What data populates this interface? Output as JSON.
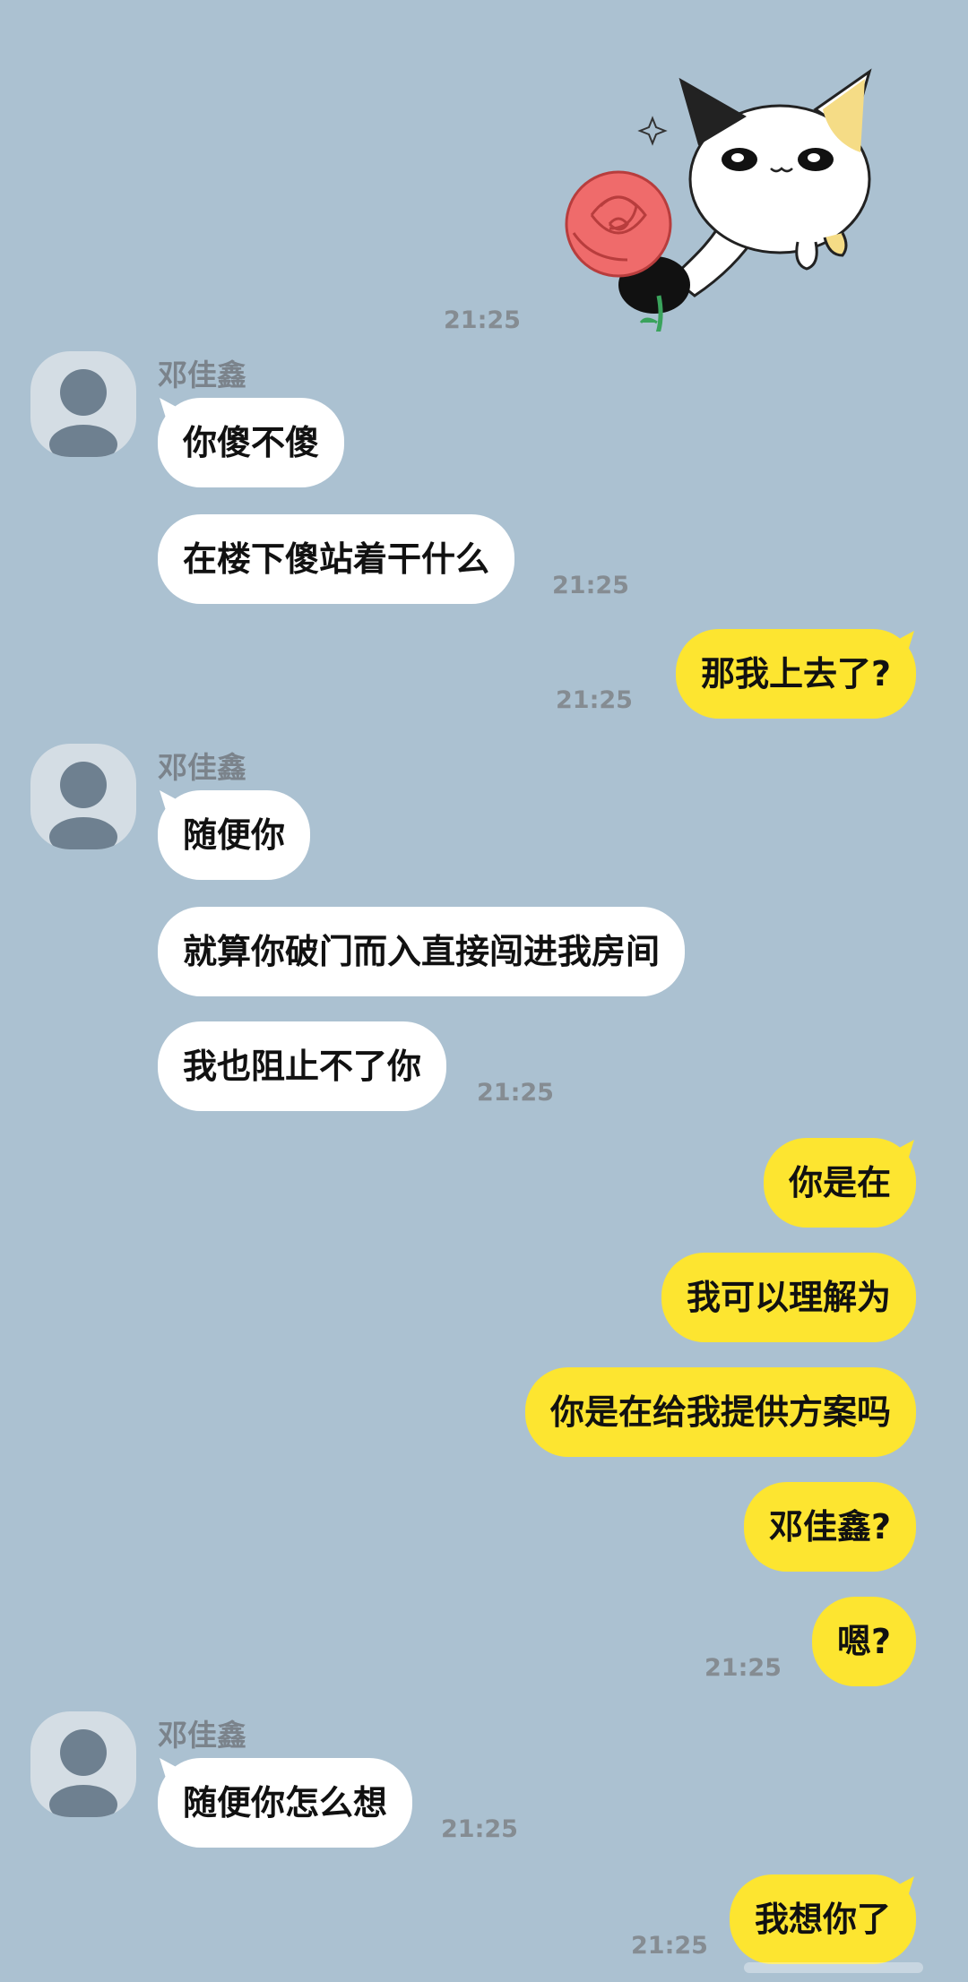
{
  "colors": {
    "background": "#abc1d1",
    "incoming_bubble": "#ffffff",
    "outgoing_bubble": "#fde530",
    "timestamp": "#858c92",
    "sender_name": "#7b838b"
  },
  "sticker": {
    "icon": "cat-holding-rose-sticker",
    "time": "21:25"
  },
  "groups": [
    {
      "sender": "邓佳鑫",
      "messages": [
        "你傻不傻",
        "在楼下傻站着干什么"
      ],
      "time": "21:25"
    },
    {
      "outgoing": [
        "那我上去了?"
      ],
      "time": "21:25"
    },
    {
      "sender": "邓佳鑫",
      "messages": [
        "随便你",
        "就算你破门而入直接闯进我房间",
        "我也阻止不了你"
      ],
      "time": "21:25"
    },
    {
      "outgoing": [
        "你是在",
        "我可以理解为",
        "你是在给我提供方案吗",
        "邓佳鑫?",
        "嗯?"
      ],
      "time": "21:25"
    },
    {
      "sender": "邓佳鑫",
      "messages": [
        "随便你怎么想"
      ],
      "time": "21:25"
    },
    {
      "outgoing": [
        "我想你了"
      ],
      "time": "21:25"
    }
  ]
}
